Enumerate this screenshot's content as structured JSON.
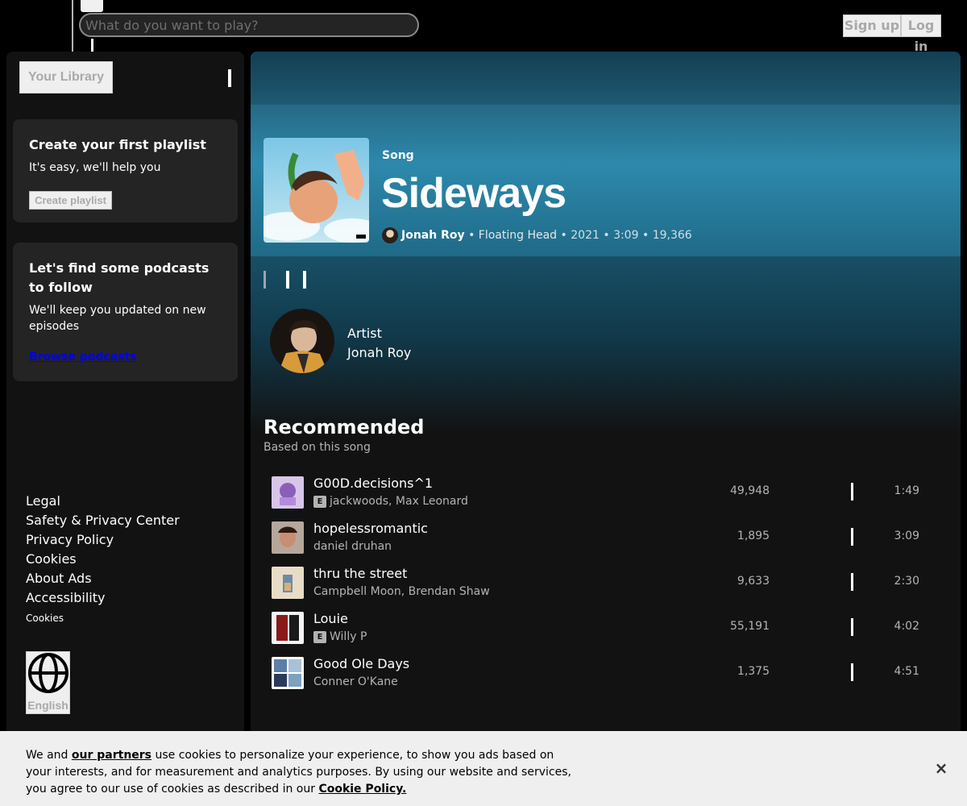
{
  "topbar": {
    "search_placeholder": "What do you want to play?",
    "signup_label": "Sign up",
    "login_label": "Log in"
  },
  "sidebar": {
    "library_label": "Your Library",
    "playlist_card": {
      "title": "Create your first playlist",
      "text": "It's easy, we'll help you",
      "button": "Create playlist"
    },
    "podcast_card": {
      "title": "Let's find some podcasts to follow",
      "text": "We'll keep you updated on new episodes",
      "link": "Browse podcasts"
    },
    "footer_links": [
      "Legal",
      "Safety & Privacy Center",
      "Privacy Policy",
      "Cookies",
      "About Ads",
      "Accessibility"
    ],
    "cookies_small": "Cookies",
    "language": "English"
  },
  "song": {
    "type": "Song",
    "title": "Sideways",
    "artist": "Jonah Roy",
    "album": "Floating Head",
    "year": "2021",
    "duration": "3:09",
    "plays": "19,366",
    "separator": "•"
  },
  "artist_section": {
    "label": "Artist",
    "name": "Jonah Roy"
  },
  "recommended": {
    "title": "Recommended",
    "subtitle": "Based on this song",
    "explicit_badge": "E",
    "tracks": [
      {
        "name": "G00D.decisions^1",
        "artists": "jackwoods, Max Leonard",
        "explicit": true,
        "plays": "49,948",
        "duration": "1:49"
      },
      {
        "name": "hopelessromantic",
        "artists": "daniel druhan",
        "explicit": false,
        "plays": "1,895",
        "duration": "3:09"
      },
      {
        "name": "thru the street",
        "artists": "Campbell Moon, Brendan Shaw",
        "explicit": false,
        "plays": "9,633",
        "duration": "2:30"
      },
      {
        "name": "Louie",
        "artists": "Willy P",
        "explicit": true,
        "plays": "55,191",
        "duration": "4:02"
      },
      {
        "name": "Good Ole Days",
        "artists": "Conner O'Kane",
        "explicit": false,
        "plays": "1,375",
        "duration": "4:51"
      }
    ]
  },
  "cookie_banner": {
    "prefix": "We and",
    "partners_link": "our partners",
    "body": "use cookies to personalize your experience, to show you ads based on your interests, and for measurement and analytics purposes. By using our website and services, you agree to our use of cookies as described in our",
    "policy_link": "Cookie Policy.",
    "close": "×"
  }
}
